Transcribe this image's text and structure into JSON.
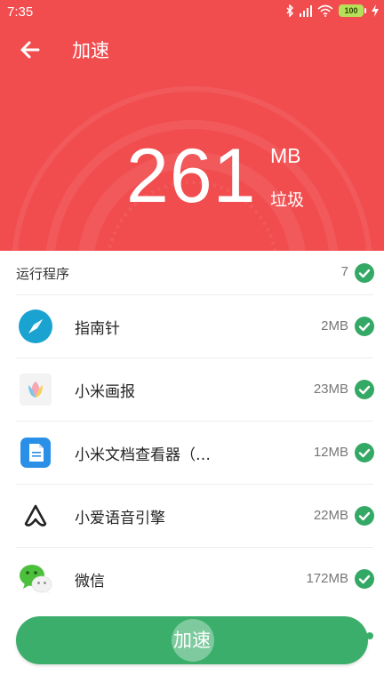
{
  "status_bar": {
    "time": "7:35",
    "battery": "100",
    "icons": [
      "bluetooth-icon",
      "signal-icon",
      "wifi-icon",
      "battery-icon",
      "charging-icon"
    ]
  },
  "header": {
    "title": "加速",
    "amount": "261",
    "unit": "MB",
    "unit_label": "垃圾",
    "background_color": "#f14d4f"
  },
  "section": {
    "label": "运行程序",
    "count": "7"
  },
  "apps": [
    {
      "name": "指南针",
      "size": "2MB",
      "icon": "compass-icon"
    },
    {
      "name": "小米画报",
      "size": "23MB",
      "icon": "mi-wallpaper-icon"
    },
    {
      "name": "小米文档查看器（…",
      "size": "12MB",
      "icon": "document-viewer-icon"
    },
    {
      "name": "小爱语音引擎",
      "size": "22MB",
      "icon": "voice-engine-icon"
    },
    {
      "name": "微信",
      "size": "172MB",
      "icon": "wechat-icon"
    }
  ],
  "boost_button": {
    "label": "加速",
    "color": "#3aae6a"
  },
  "check_color": "#34a865"
}
